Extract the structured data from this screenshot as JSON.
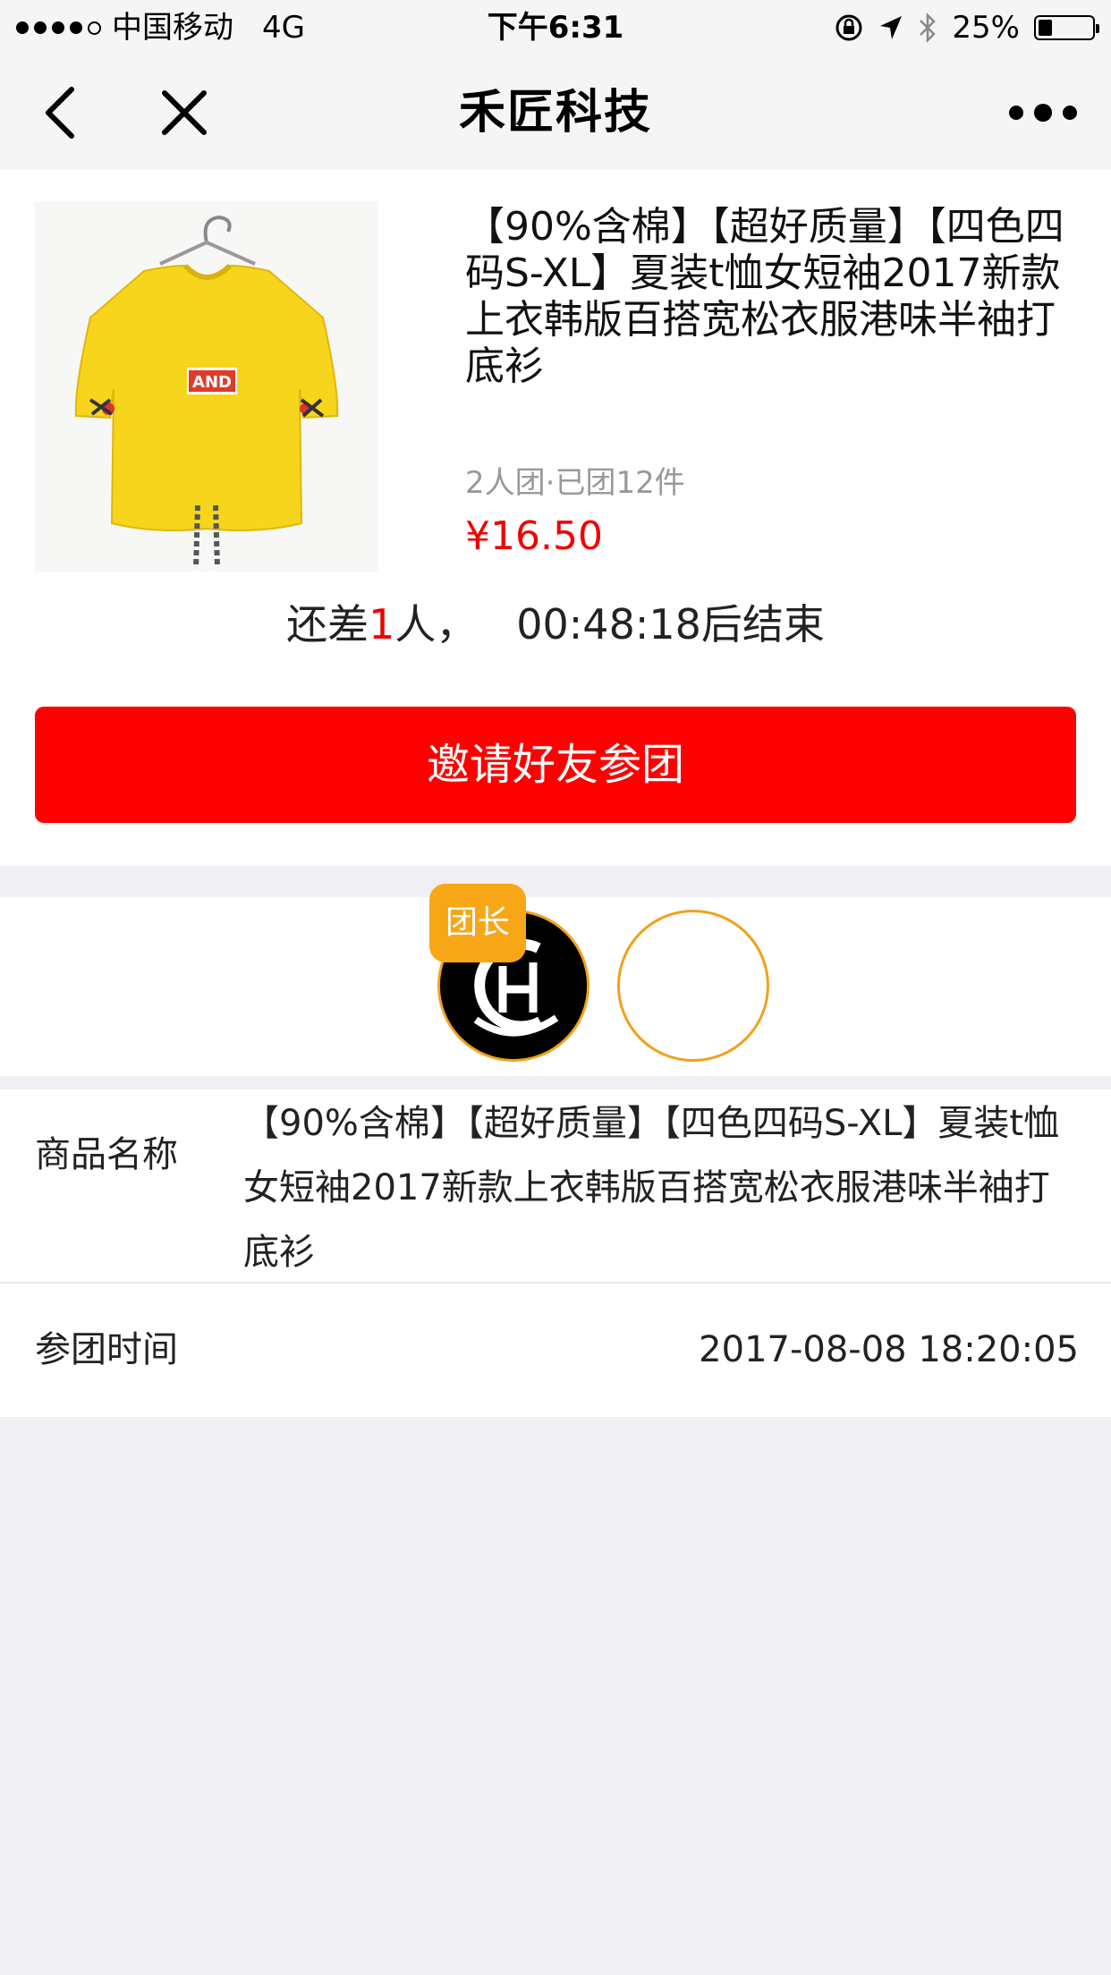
{
  "status_bar": {
    "carrier": "中国移动",
    "network": "4G",
    "time": "下午6:31",
    "battery": "25%",
    "battery_level": 0.25
  },
  "nav": {
    "title": "禾匠科技",
    "back_icon": "chevron-left-icon",
    "close_icon": "close-icon",
    "more_icon": "more-dots-icon"
  },
  "product": {
    "title": "【90%含棉】【超好质量】【四色四码S-XL】夏装t恤女短袖2017新款上衣韩版百搭宽松衣服港味半袖打底衫",
    "image_print_text": "AND",
    "group_info": "2人团·已团12件",
    "price": "¥16.50"
  },
  "countdown": {
    "prefix": "还差",
    "needed": "1",
    "middle": "人，",
    "timer": "00:48:18",
    "suffix": "后结束"
  },
  "invite_button": "邀请好友参团",
  "members": {
    "leader_badge": "团长"
  },
  "info": {
    "name_label": "商品名称",
    "name_value": "【90%含棉】【超好质量】【四色四码S-XL】夏装t恤女短袖2017新款上衣韩版百搭宽松衣服港味半袖打底衫",
    "time_label": "参团时间",
    "time_value": "2017-08-08 18:20:05"
  },
  "colors": {
    "accent_red": "#ff0000",
    "price_red": "#f20000",
    "leader_orange": "#f7a716",
    "page_bg": "#efeff4"
  }
}
